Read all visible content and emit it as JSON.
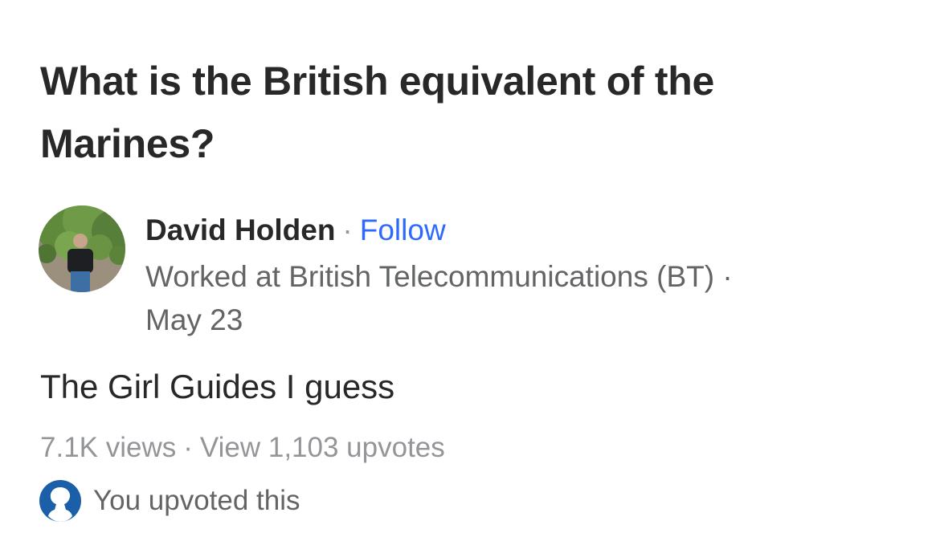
{
  "question": {
    "title": "What is the British equivalent of the Marines?"
  },
  "author": {
    "name": "David Holden",
    "separator": "·",
    "follow_label": "Follow",
    "credential": "Worked at British Telecommunications (BT) ·",
    "date": "May 23",
    "avatar_icon": "profile-photo"
  },
  "answer": {
    "text": "The Girl Guides I guess"
  },
  "stats": {
    "views": "7.1K views",
    "separator": "·",
    "upvotes_label": "View 1,103 upvotes"
  },
  "upvoted": {
    "icon": "user-silhouette-icon",
    "text": "You upvoted this"
  },
  "colors": {
    "title": "#282829",
    "link": "#2e69ff",
    "secondary": "#636466",
    "muted": "#939598",
    "upvote_icon": "#1a5fa8"
  }
}
